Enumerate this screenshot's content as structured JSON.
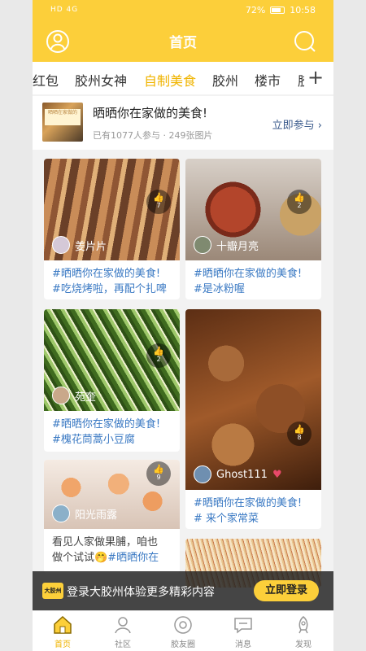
{
  "status": {
    "left": "HD 4G",
    "battery": "72%",
    "time": "10:58"
  },
  "header": {
    "title": "首页"
  },
  "tabs": [
    "红包",
    "胶州女神",
    "自制美食",
    "胶州",
    "楼市",
    "胶"
  ],
  "banner": {
    "thumb_text": "晒晒在家做的",
    "title": "晒晒你在家做的美食!",
    "subtitle": "已有1077人参与 · 249张图片",
    "link": "立即参与 ›"
  },
  "posts": [
    {
      "user": "姜片片",
      "likes": "7",
      "tag": "#晒晒你在家做的美食!",
      "text": "#吃烧烤啦，再配个扎啤"
    },
    {
      "user": "十瓣月亮",
      "likes": "2",
      "tag": "#晒晒你在家做的美食!",
      "text": "#是冰粉喔"
    },
    {
      "user": "苑奎",
      "likes": "2",
      "tag": "#晒晒你在家做的美食!",
      "text": "#槐花茼蒿小豆腐"
    },
    {
      "user": "Ghost111",
      "likes": "8",
      "tag": "#晒晒你在家做的美食!",
      "text": "# 来个家常菜"
    },
    {
      "user": "阳光雨露",
      "likes": "9",
      "text_line1": "看见人家做果脯，咱也",
      "text_line2_plain": "做个试试",
      "emoji": "🤭",
      "text_line2_hash": "#晒晒你在"
    }
  ],
  "login": {
    "logo": "大胶州",
    "text": "登录大胶州体验更多精彩内容",
    "button": "立即登录"
  },
  "nav": [
    "首页",
    "社区",
    "胶友圈",
    "消息",
    "发现"
  ],
  "colors": {
    "brand": "#fccf3a",
    "active_tab": "#f0b400",
    "hashtag": "#3a79c3"
  }
}
